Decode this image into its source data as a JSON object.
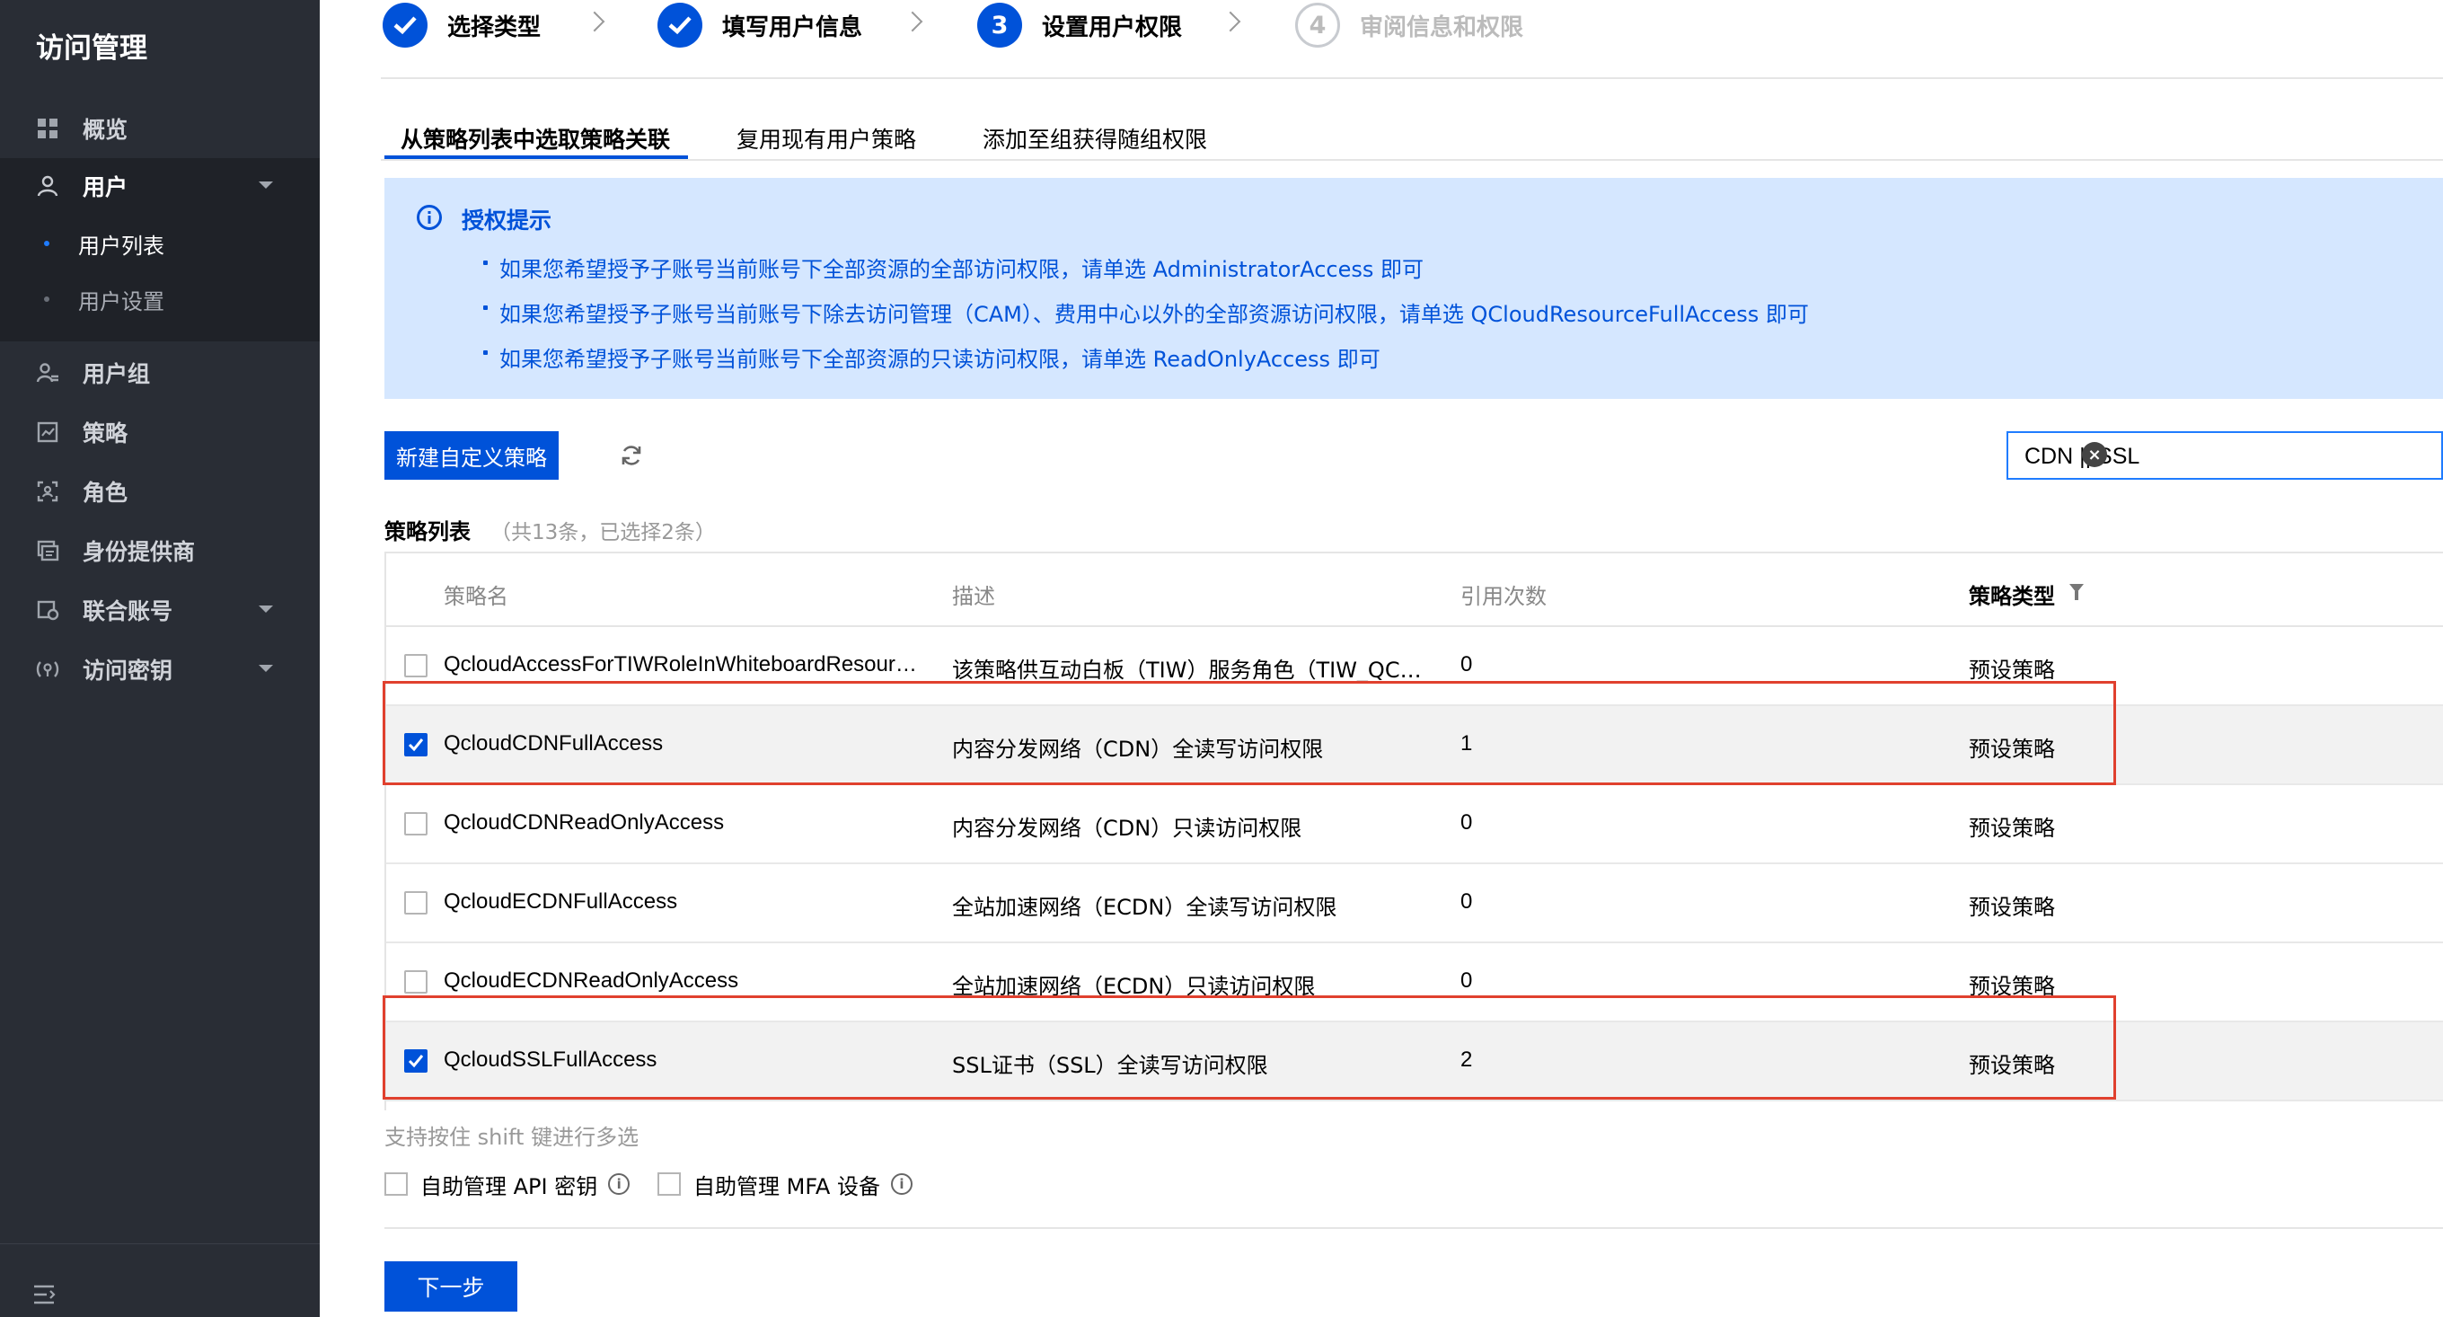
{
  "sidebar": {
    "title": "访问管理",
    "items": [
      {
        "label": "概览",
        "icon": "overview-icon"
      },
      {
        "label": "用户",
        "icon": "user-icon",
        "expanded": true
      },
      {
        "label": "用户组",
        "icon": "user-group-icon"
      },
      {
        "label": "策略",
        "icon": "policy-icon"
      },
      {
        "label": "角色",
        "icon": "role-icon"
      },
      {
        "label": "身份提供商",
        "icon": "identity-provider-icon"
      },
      {
        "label": "联合账号",
        "icon": "federated-account-icon"
      },
      {
        "label": "访问密钥",
        "icon": "access-key-icon"
      }
    ],
    "user_sub_items": [
      {
        "label": "用户列表",
        "active": true
      },
      {
        "label": "用户设置",
        "active": false
      }
    ]
  },
  "steps": [
    {
      "number": "1",
      "label": "选择类型",
      "status": "done"
    },
    {
      "number": "2",
      "label": "填写用户信息",
      "status": "done"
    },
    {
      "number": "3",
      "label": "设置用户权限",
      "status": "current"
    },
    {
      "number": "4",
      "label": "审阅信息和权限",
      "status": "pending"
    }
  ],
  "tabs": [
    {
      "label": "从策略列表中选取策略关联",
      "active": true
    },
    {
      "label": "复用现有用户策略",
      "active": false
    },
    {
      "label": "添加至组获得随组权限",
      "active": false
    }
  ],
  "notice": {
    "title": "授权提示",
    "lines": [
      "如果您希望授予子账号当前账号下全部资源的全部访问权限，请单选 AdministratorAccess 即可",
      "如果您希望授予子账号当前账号下除去访问管理（CAM）、费用中心以外的全部资源访问权限，请单选 QCloudResourceFullAccess 即可",
      "如果您希望授予子账号当前账号下全部资源的只读访问权限，请单选 ReadOnlyAccess 即可"
    ]
  },
  "toolbar": {
    "new_policy_label": "新建自定义策略",
    "search_value": "CDN || SSL"
  },
  "policy_list": {
    "title": "策略列表",
    "count_text": "（共13条，已选择2条）",
    "columns": [
      "策略名",
      "描述",
      "引用次数",
      "策略类型"
    ],
    "rows": [
      {
        "name": "QcloudAccessForTIWRoleInWhiteboardResour…",
        "desc": "该策略供互动白板（TIW）服务角色（TIW_QC…",
        "refs": "0",
        "type": "预设策略",
        "checked": false
      },
      {
        "name": "QcloudCDNFullAccess",
        "desc": "内容分发网络（CDN）全读写访问权限",
        "refs": "1",
        "type": "预设策略",
        "checked": true
      },
      {
        "name": "QcloudCDNReadOnlyAccess",
        "desc": "内容分发网络（CDN）只读访问权限",
        "refs": "0",
        "type": "预设策略",
        "checked": false
      },
      {
        "name": "QcloudECDNFullAccess",
        "desc": "全站加速网络（ECDN）全读写访问权限",
        "refs": "0",
        "type": "预设策略",
        "checked": false
      },
      {
        "name": "QcloudECDNReadOnlyAccess",
        "desc": "全站加速网络（ECDN）只读访问权限",
        "refs": "0",
        "type": "预设策略",
        "checked": false
      },
      {
        "name": "QcloudSSLFullAccess",
        "desc": "SSL证书（SSL）全读写访问权限",
        "refs": "2",
        "type": "预设策略",
        "checked": true
      }
    ]
  },
  "shift_tip": "支持按住 shift 键进行多选",
  "options": [
    {
      "label": "自助管理 API 密钥",
      "checked": false
    },
    {
      "label": "自助管理 MFA 设备",
      "checked": false
    }
  ],
  "next_label": "下一步",
  "colors": {
    "primary": "#0052d9",
    "sidebar_bg": "#292d35",
    "notice_bg": "#d5e7ff",
    "highlight_red": "#e0402e"
  }
}
